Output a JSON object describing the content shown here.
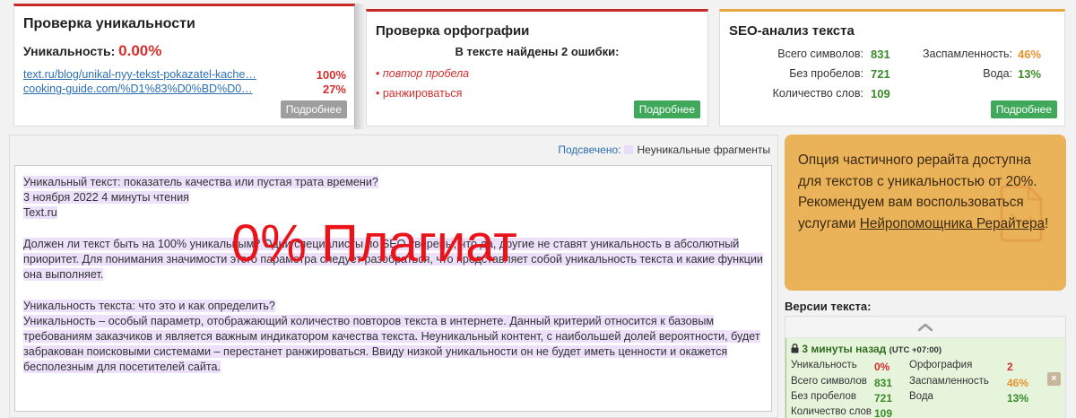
{
  "uniqueness_card": {
    "title": "Проверка уникальности",
    "uniqueness_label": "Уникальность:",
    "uniqueness_value": "0.00%",
    "sources": [
      {
        "url": "text.ru/blog/unikal-nyy-tekst-pokazatel-kache…",
        "percent": "100%"
      },
      {
        "url": "cooking-guide.com/%D1%83%D0%BD%D0…",
        "percent": "27%"
      }
    ],
    "more_label": "Подробнее"
  },
  "spelling_card": {
    "title": "Проверка орфографии",
    "subtitle": "В тексте найдены 2 ошибки:",
    "errors": [
      "повтор пробела",
      "ранжироваться"
    ],
    "more_label": "Подробнее"
  },
  "seo_card": {
    "title": "SEO-анализ текста",
    "chars_label": "Всего символов:",
    "chars_value": "831",
    "no_spaces_label": "Без пробелов:",
    "no_spaces_value": "721",
    "words_label": "Количество слов:",
    "words_value": "109",
    "spam_label": "Заспамленность:",
    "spam_value": "46%",
    "water_label": "Вода:",
    "water_value": "13%",
    "more_label": "Подробнее"
  },
  "text_panel": {
    "legend_link": "Подсвечено:",
    "legend_label": "Неуникальные фрагменты",
    "overlay": "0% Плагиат",
    "paragraphs": [
      [
        "Уникальный текст: показатель качества или пустая трата времени?",
        "3 ноября 2022  4 минуты чтения",
        "Text.ru"
      ],
      [
        "Должен ли текст быть на 100% уникальным? Одни специалисты по SEO уверены, что да, другие не ставят уникальность в абсолютный приоритет. Для понимания значимости этого параметра следует разобраться, что представляет собой уникальность текста и какие функции она выполняет."
      ],
      [
        "Уникальность текста: что это и как определить?",
        "Уникальность – особый параметр, отображающий количество повторов текста в интернете. Данный критерий относится к базовым требованиям заказчиков и является важным индикатором качества текста. Неуникальный контент, с наибольшей долей вероятности, будет забракован поисковыми системами – перестанет ранжироваться. Ввиду низкой уникальности он не будет иметь ценности и окажется бесполезным для посетителей сайта."
      ]
    ]
  },
  "rewrite_card": {
    "text_before": "Опция частичного рерайта доступна для текстов с уникальностью от 20%. Рекомендуем вам воспользоваться услугами ",
    "link_text": "Нейропомощника Рерайтера",
    "text_after": "!",
    "icon": "document-icon"
  },
  "versions": {
    "title": "Версии текста:",
    "up_icon": "chevron-up-icon",
    "current": {
      "time": "3 минуты назад",
      "timezone": "(UTC +07:00)",
      "uniq_label": "Уникальность",
      "uniq_value": "0%",
      "spell_label": "Орфография",
      "spell_value": "2",
      "chars_label": "Всего символов",
      "chars_value": "831",
      "spam_label": "Заспамленность",
      "spam_value": "46%",
      "no_spaces_label": "Без пробелов",
      "no_spaces_value": "721",
      "water_label": "Вода",
      "water_value": "13%",
      "words_label": "Количество слов",
      "words_value": "109"
    },
    "close_icon": "close-icon"
  }
}
